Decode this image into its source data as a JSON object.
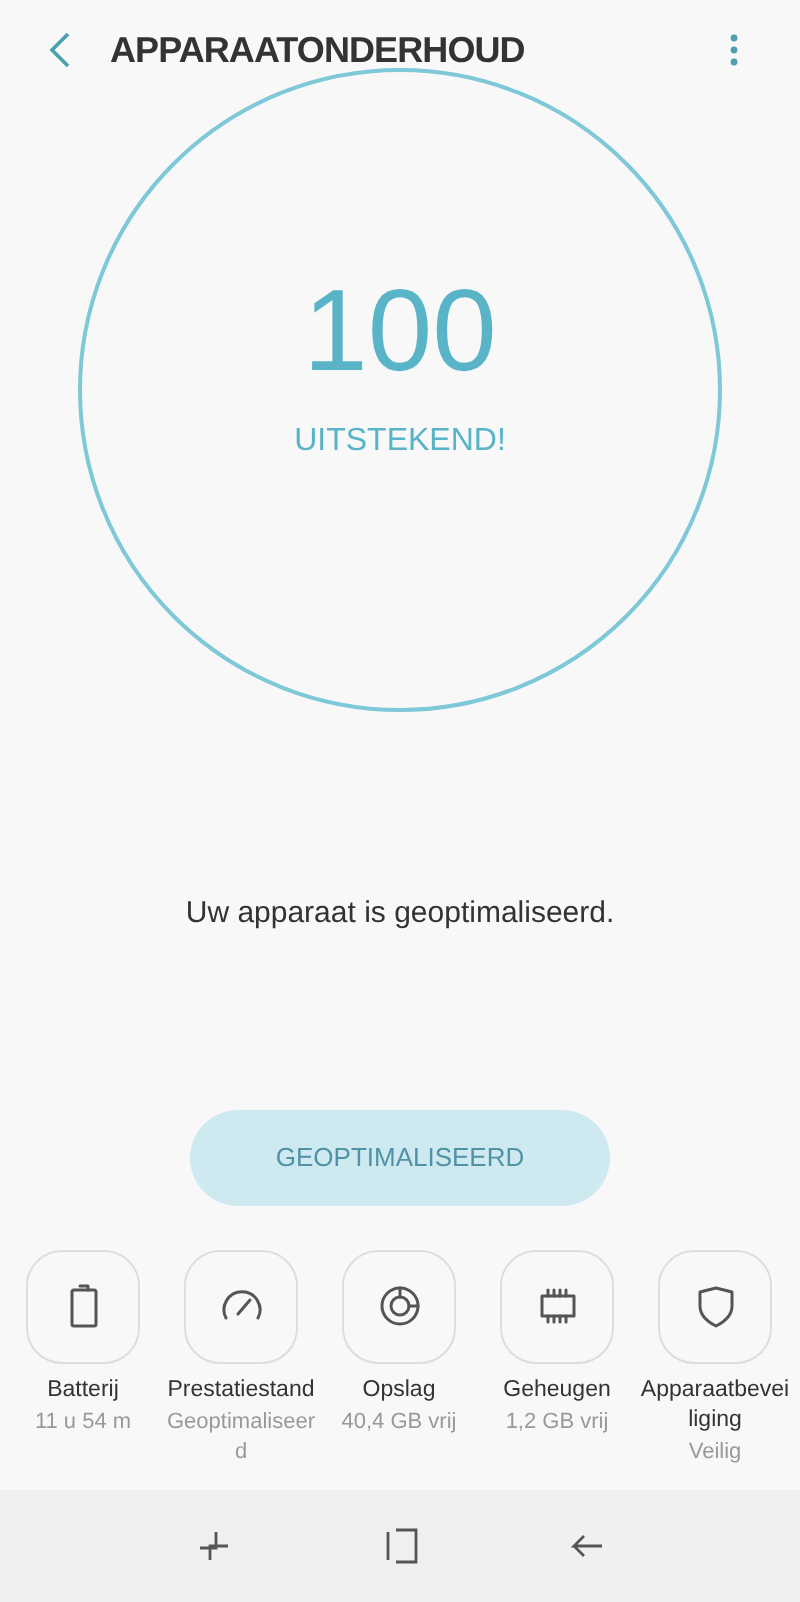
{
  "header": {
    "title": "APPARAATONDERHOUD"
  },
  "score": {
    "value": "100",
    "rating": "UITSTEKEND!"
  },
  "message": "Uw apparaat is geoptimaliseerd.",
  "optimize_button": {
    "label": "GEOPTIMALISEERD",
    "disabled": true
  },
  "tiles": [
    {
      "kind": "battery",
      "label": "Batterij",
      "status": "11 u 54 m"
    },
    {
      "kind": "performance",
      "label": "Prestatiestand",
      "status": "Geoptimaliseerd"
    },
    {
      "kind": "storage",
      "label": "Opslag",
      "status": "40,4 GB vrij"
    },
    {
      "kind": "memory",
      "label": "Geheugen",
      "status": "1,2 GB vrij"
    },
    {
      "kind": "security",
      "label": "Apparaatbeveiliging",
      "status": "Veilig"
    }
  ]
}
